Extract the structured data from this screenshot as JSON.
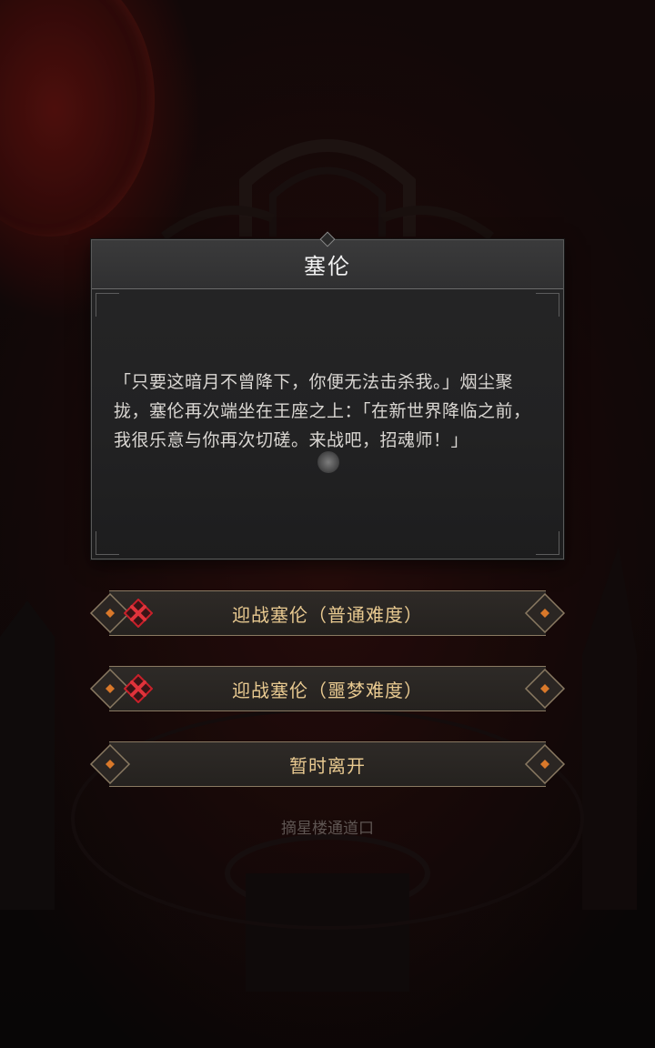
{
  "dialog": {
    "title": "塞伦",
    "text": "「只要这暗月不曾降下，你便无法击杀我。」烟尘聚拢，塞伦再次端坐在王座之上：「在新世界降临之前，我很乐意与你再次切磋。来战吧，招魂师！」"
  },
  "options": [
    {
      "label": "迎战塞伦（普通难度）",
      "locked": true
    },
    {
      "label": "迎战塞伦（噩梦难度）",
      "locked": true
    },
    {
      "label": "暂时离开",
      "locked": false
    }
  ],
  "location": "摘星楼通道口",
  "colors": {
    "option_text": "#e8c990",
    "lock_cross": "#c8202a",
    "dialog_bg": "#232324"
  }
}
